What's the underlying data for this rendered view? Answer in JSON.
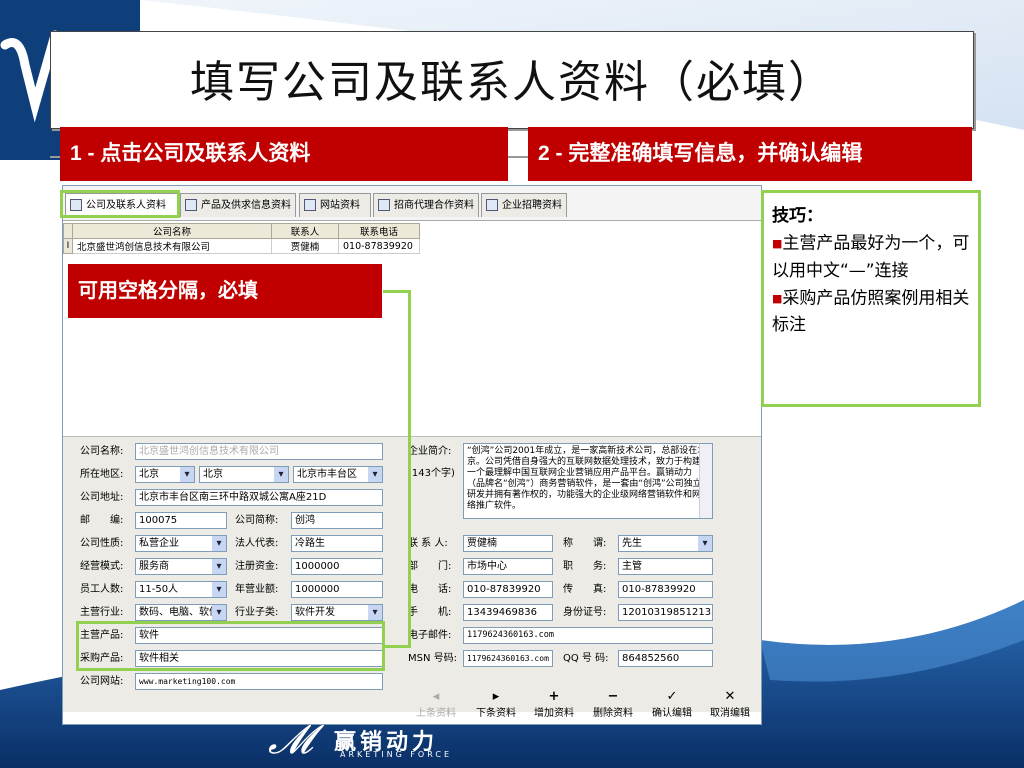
{
  "title": "填写公司及联系人资料（必填）",
  "step1": "1 - 点击公司及联系人资料",
  "step2": "2 - 完整准确填写信息，并确认编辑",
  "note": "可用空格分隔，必填",
  "tabs": [
    {
      "label": "公司及联系人资料",
      "active": true
    },
    {
      "label": "产品及供求信息资料",
      "active": false
    },
    {
      "label": "网站资料",
      "active": false
    },
    {
      "label": "招商代理合作资料",
      "active": false
    },
    {
      "label": "企业招聘资料",
      "active": false
    }
  ],
  "grid": {
    "headers": [
      "公司名称",
      "联系人",
      "联系电话"
    ],
    "row_marker": "I",
    "rows": [
      [
        "北京盛世鸿创信息技术有限公司",
        "贾健楠",
        "010-87839920"
      ]
    ]
  },
  "form": {
    "company_name": {
      "label": "公司名称:",
      "value": "北京盛世鸿创信息技术有限公司"
    },
    "region": {
      "label": "所在地区:",
      "province": "北京",
      "city": "北京",
      "district": "北京市丰台区"
    },
    "address": {
      "label": "公司地址:",
      "value": "北京市丰台区南三环中路双城公寓A座21D"
    },
    "postcode": {
      "label": "邮　　编:",
      "value": "100075"
    },
    "short_name": {
      "label": "公司简称:",
      "value": "创鸿"
    },
    "nature": {
      "label": "公司性质:",
      "value": "私营企业"
    },
    "legal_rep": {
      "label": "法人代表:",
      "value": "冷路生"
    },
    "mode": {
      "label": "经营模式:",
      "value": "服务商"
    },
    "capital": {
      "label": "注册资金:",
      "value": "1000000"
    },
    "staff": {
      "label": "员工人数:",
      "value": "11-50人"
    },
    "revenue": {
      "label": "年营业额:",
      "value": "1000000"
    },
    "industry": {
      "label": "主营行业:",
      "value": "数码、电脑、软件"
    },
    "sub_industry": {
      "label": "行业子类:",
      "value": "软件开发"
    },
    "main_product": {
      "label": "主营产品:",
      "value": "软件"
    },
    "purchase": {
      "label": "采购产品:",
      "value": "软件相关"
    },
    "website": {
      "label": "公司网站:",
      "value": "www.marketing100.com"
    },
    "intro": {
      "label": "企业简介:",
      "count": "(143个字)",
      "value": "“创鸿”公司2001年成立，是一家高新技术公司，总部设在北京。公司凭借自身强大的互联网数据处理技术，致力于构建一个最理解中国互联网企业营销应用产品平台。赢销动力（品牌名“创鸿”）商务营销软件，是一套由“创鸿”公司独立研发并拥有著作权的，功能强大的企业级网络营销软件和网络推广软件。"
    },
    "contact": {
      "label": "联 系 人:",
      "value": "贾健楠"
    },
    "title": {
      "label": "称　　谓:",
      "value": "先生"
    },
    "dept": {
      "label": "部　　门:",
      "value": "市场中心"
    },
    "position": {
      "label": "职　　务:",
      "value": "主管"
    },
    "phone": {
      "label": "电　　话:",
      "value": "010-87839920"
    },
    "fax": {
      "label": "传　　真:",
      "value": "010-87839920"
    },
    "mobile": {
      "label": "手　　机:",
      "value": "13439469836"
    },
    "id_card": {
      "label": "身份证号:",
      "value": "120103198512133530"
    },
    "email": {
      "label": "电子邮件:",
      "value": "1179624360163.com"
    },
    "msn": {
      "label": "MSN 号码:",
      "value": "1179624360163.com"
    },
    "qq": {
      "label": "QQ 号 码:",
      "value": "864852560"
    }
  },
  "nav": {
    "prev": "上条资料",
    "next": "下条资料",
    "add": "增加资料",
    "delete": "删除资料",
    "confirm": "确认编辑",
    "cancel": "取消编辑"
  },
  "tips": {
    "title": "技巧：",
    "items": [
      "主营产品最好为一个，可以用中文“—”连接",
      "采购产品仿照案例用相关标注"
    ]
  },
  "brand": {
    "cn": "赢销动力",
    "en": "ARKETING FORCE"
  },
  "colors": {
    "red": "#c00000",
    "green": "#92d050",
    "navy": "#0f3f7a"
  }
}
